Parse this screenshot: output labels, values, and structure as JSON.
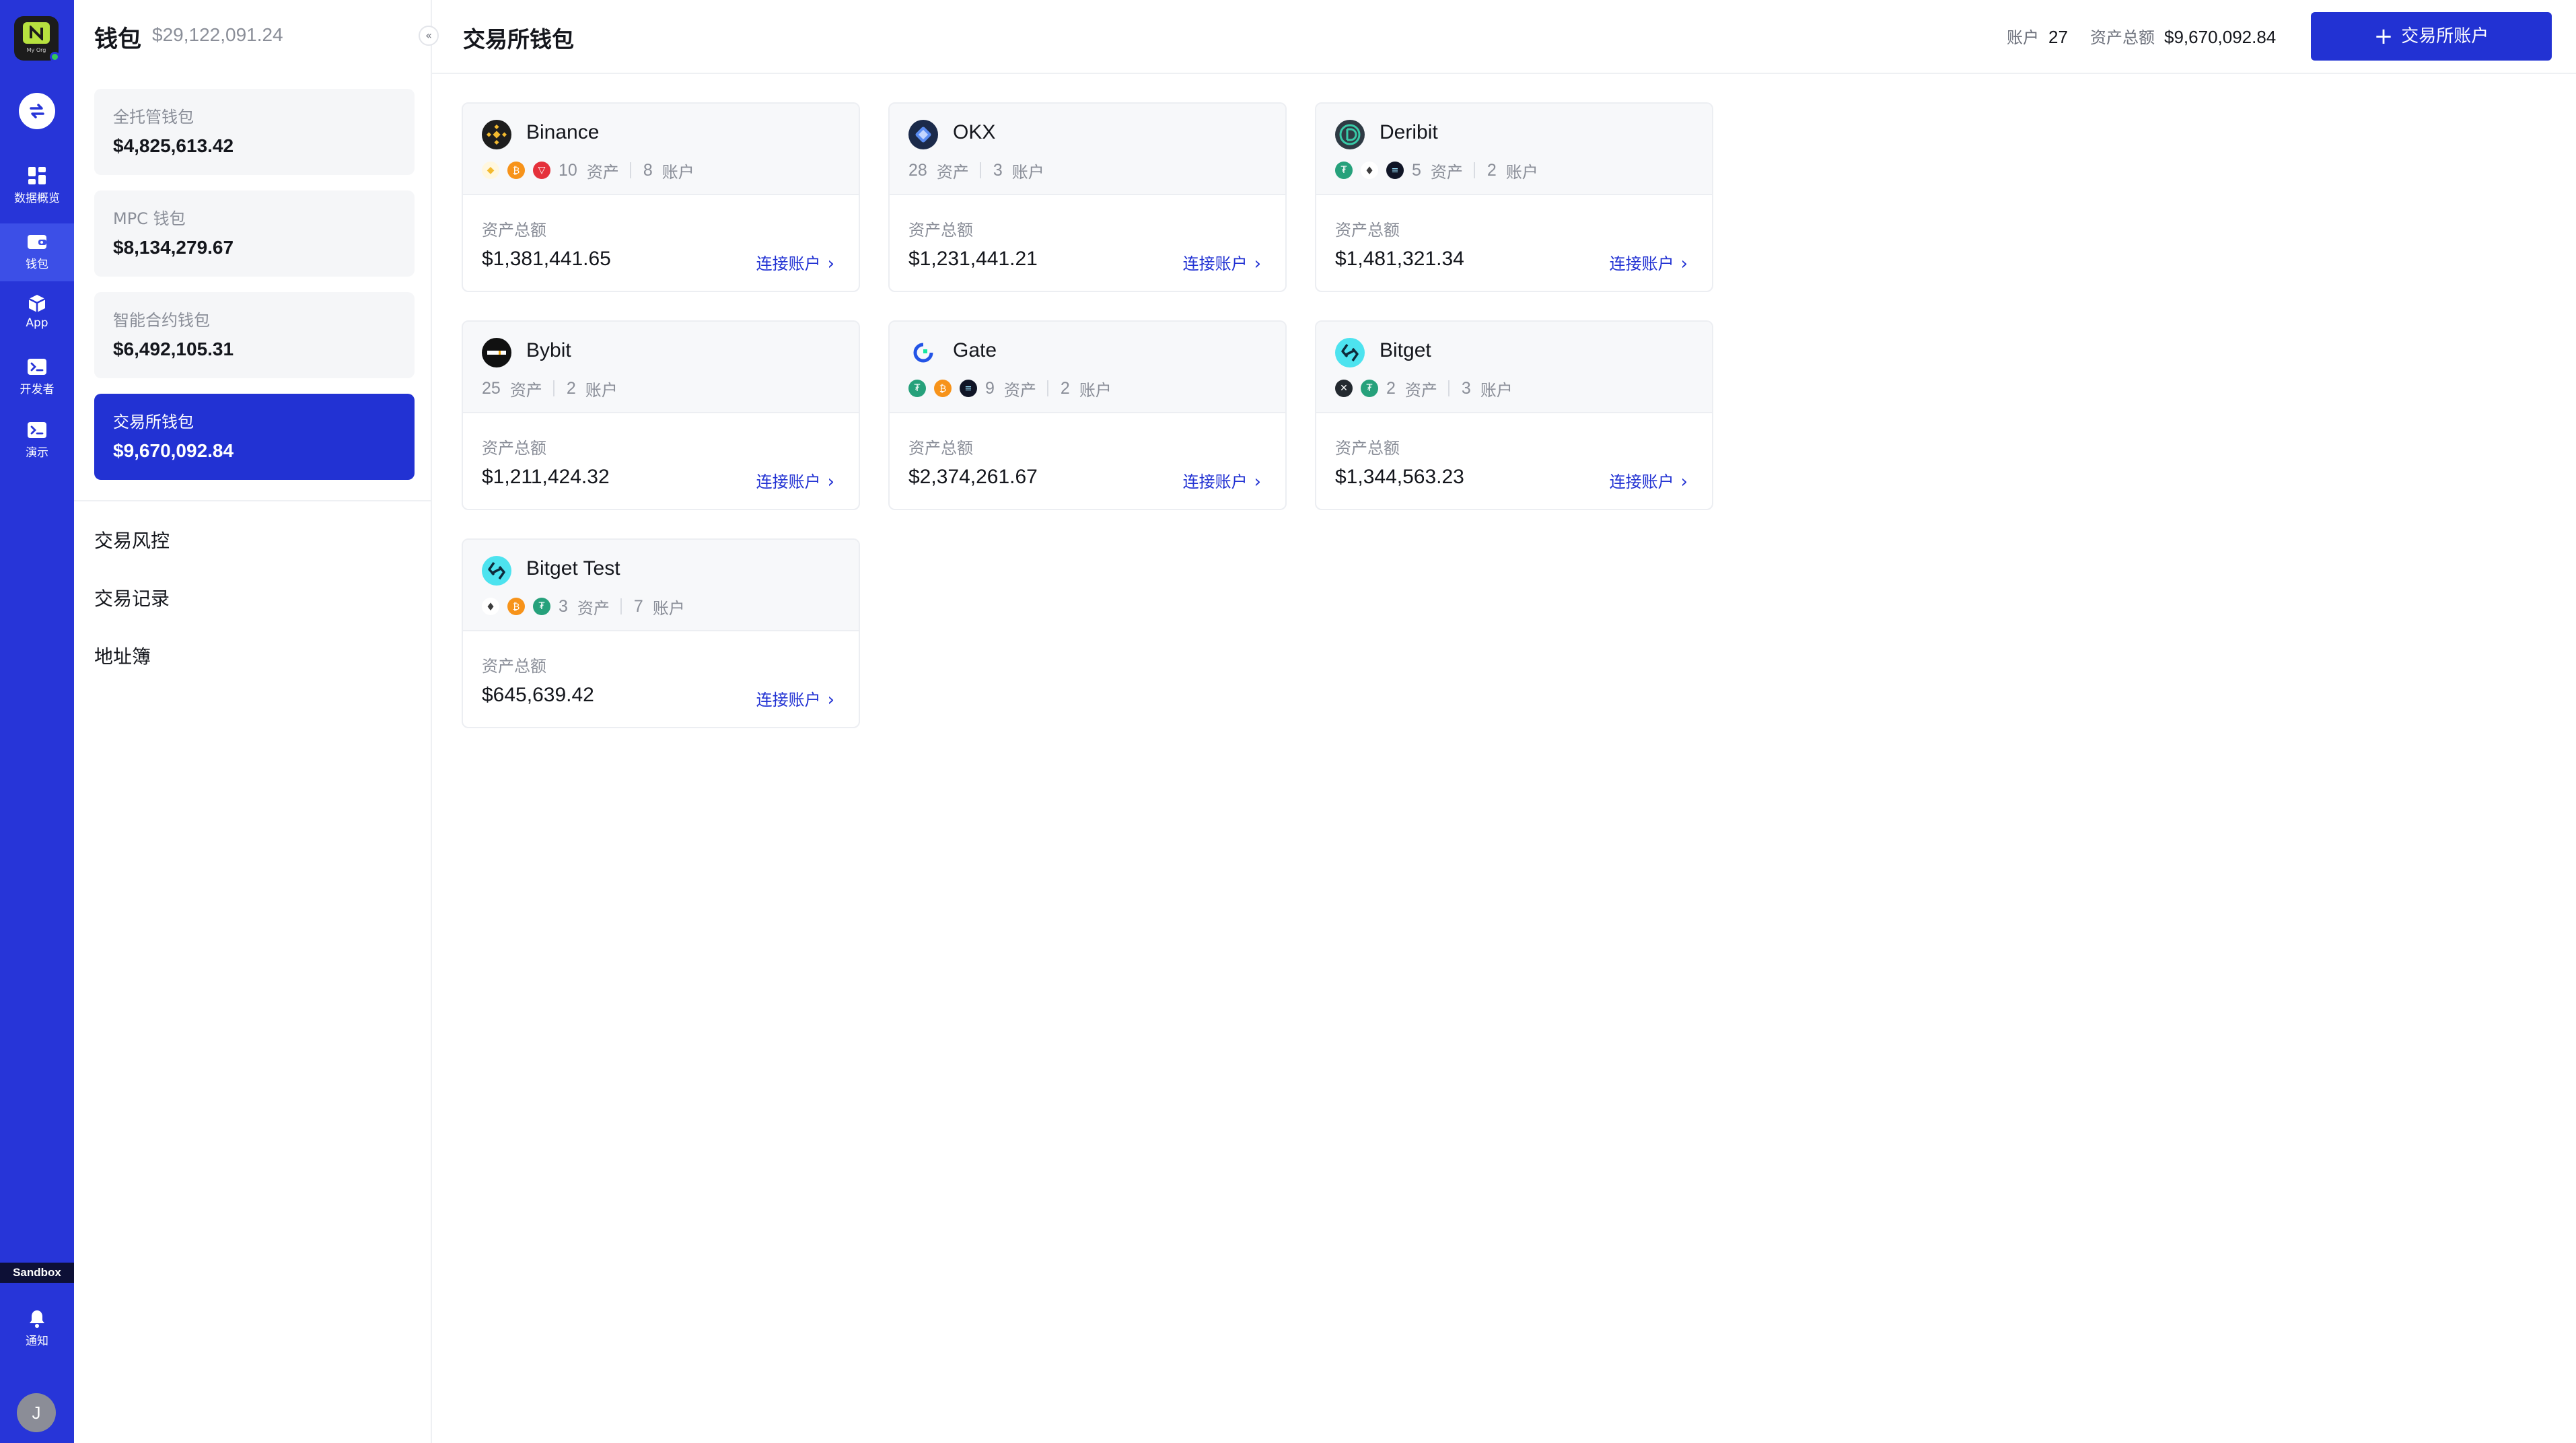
{
  "rail": {
    "logo_org": "My Org",
    "items": [
      {
        "label": "数据概览",
        "icon": "dashboard-icon"
      },
      {
        "label": "钱包",
        "icon": "wallet-icon"
      },
      {
        "label": "App",
        "icon": "cube-icon"
      },
      {
        "label": "开发者",
        "icon": "terminal-icon"
      },
      {
        "label": "演示",
        "icon": "terminal-icon"
      }
    ],
    "sandbox": "Sandbox",
    "notify": "通知",
    "avatar": "J"
  },
  "sidebar": {
    "title": "钱包",
    "total": "$29,122,091.24",
    "wallets": [
      {
        "label": "全托管钱包",
        "value": "$4,825,613.42"
      },
      {
        "label": "MPC 钱包",
        "value": "$8,134,279.67"
      },
      {
        "label": "智能合约钱包",
        "value": "$6,492,105.31"
      },
      {
        "label": "交易所钱包",
        "value": "$9,670,092.84"
      }
    ],
    "links": [
      "交易风控",
      "交易记录",
      "地址簿"
    ]
  },
  "header": {
    "title": "交易所钱包",
    "accounts_label": "账户",
    "accounts_value": "27",
    "total_label": "资产总额",
    "total_value": "$9,670,092.84",
    "add_button": "交易所账户"
  },
  "card_labels": {
    "assets": "资产",
    "accounts": "账户",
    "total": "资产总额",
    "connect": "连接账户"
  },
  "exchanges": [
    {
      "name": "Binance",
      "coins": [
        "bnb",
        "btc",
        "trx"
      ],
      "assets": "10",
      "accounts": "8",
      "total": "$1,381,441.65"
    },
    {
      "name": "OKX",
      "coins": [],
      "assets": "28",
      "accounts": "3",
      "total": "$1,231,441.21"
    },
    {
      "name": "Deribit",
      "coins": [
        "usdt",
        "eth",
        "sol"
      ],
      "assets": "5",
      "accounts": "2",
      "total": "$1,481,321.34"
    },
    {
      "name": "Bybit",
      "coins": [],
      "assets": "25",
      "accounts": "2",
      "total": "$1,211,424.32"
    },
    {
      "name": "Gate",
      "coins": [
        "usdt",
        "btc",
        "sol"
      ],
      "assets": "9",
      "accounts": "2",
      "total": "$2,374,261.67"
    },
    {
      "name": "Bitget",
      "coins": [
        "xrp",
        "usdt"
      ],
      "assets": "2",
      "accounts": "3",
      "total": "$1,344,563.23"
    },
    {
      "name": "Bitget Test",
      "coins": [
        "eth",
        "btc",
        "usdt"
      ],
      "assets": "3",
      "accounts": "7",
      "total": "$645,639.42"
    }
  ],
  "colors": {
    "rail": "#2735d8",
    "accent": "#2232d3",
    "usdt": "#26a17b",
    "btc": "#f7931a",
    "trx": "#e5313b",
    "bnb": "#f3ba2f"
  }
}
